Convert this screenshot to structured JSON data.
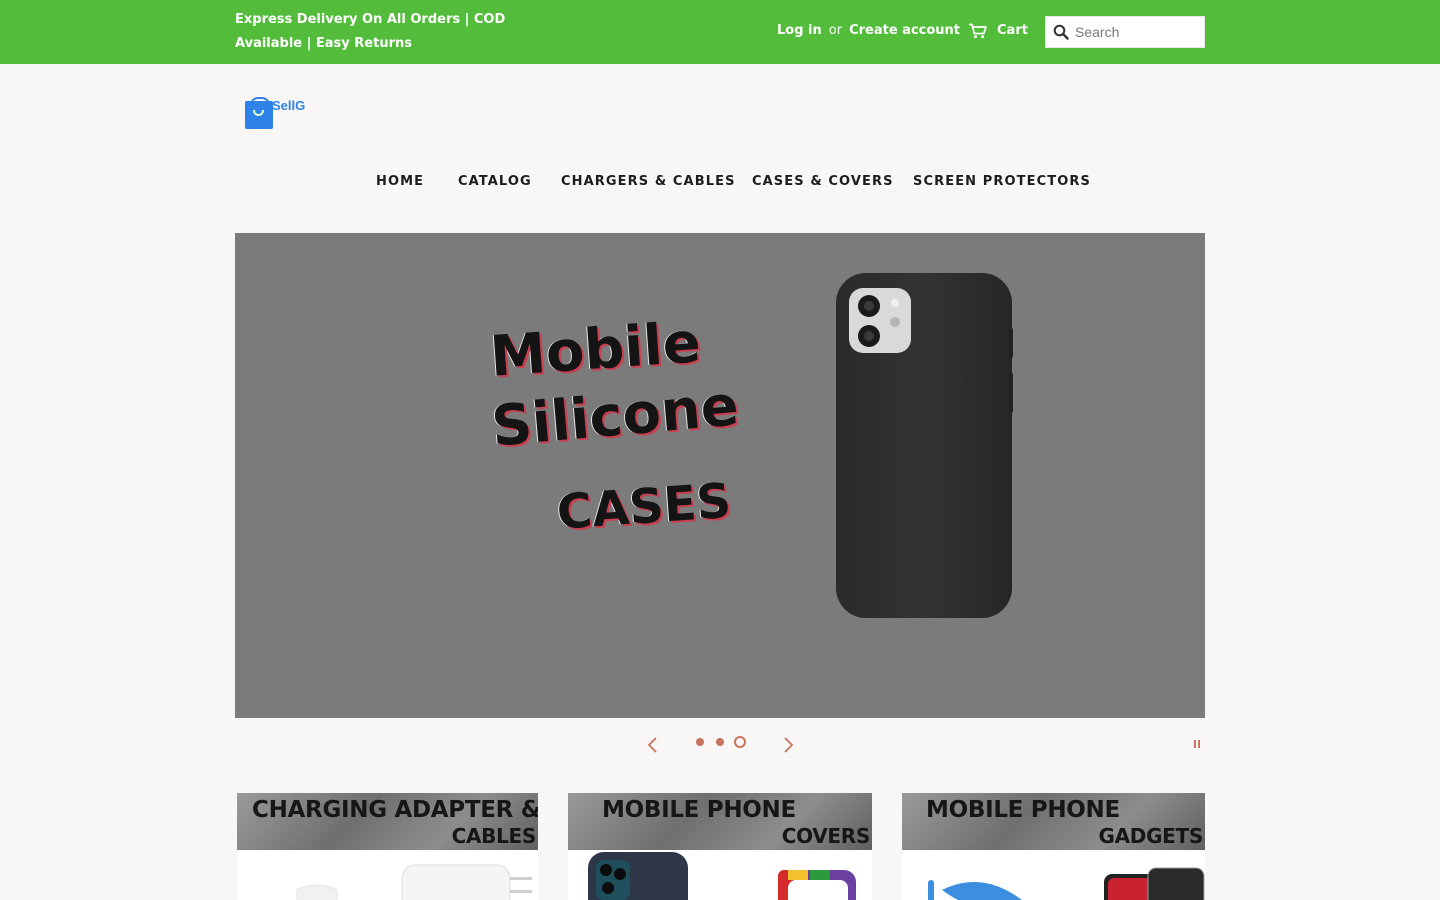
{
  "topbar": {
    "announcement": "Express Delivery On All Orders | COD Available | Easy Returns",
    "login": "Log in",
    "or": "or",
    "create_account": "Create account",
    "cart": "Cart",
    "search_placeholder": "Search"
  },
  "logo": {
    "text": "SellG"
  },
  "nav": {
    "items": [
      {
        "label": "HOME"
      },
      {
        "label": "CATALOG"
      },
      {
        "label": "CHARGERS & CABLES"
      },
      {
        "label": "CASES & COVERS"
      },
      {
        "label": "SCREEN PROTECTORS"
      }
    ]
  },
  "hero": {
    "line1": "Mobile",
    "line2": "Silicone",
    "line3": "CASES",
    "slide_count": 3,
    "active_slide": 3
  },
  "colors": {
    "topbar": "#53bd3b",
    "accent": "#c7735f",
    "page_bg": "#f8f7f5"
  },
  "collections": [
    {
      "line1": "CHARGING ADAPTER &",
      "line2": "CABLES"
    },
    {
      "line1": "MOBILE PHONE",
      "line2": "COVERS"
    },
    {
      "line1": "MOBILE PHONE",
      "line2": "GADGETS"
    }
  ]
}
